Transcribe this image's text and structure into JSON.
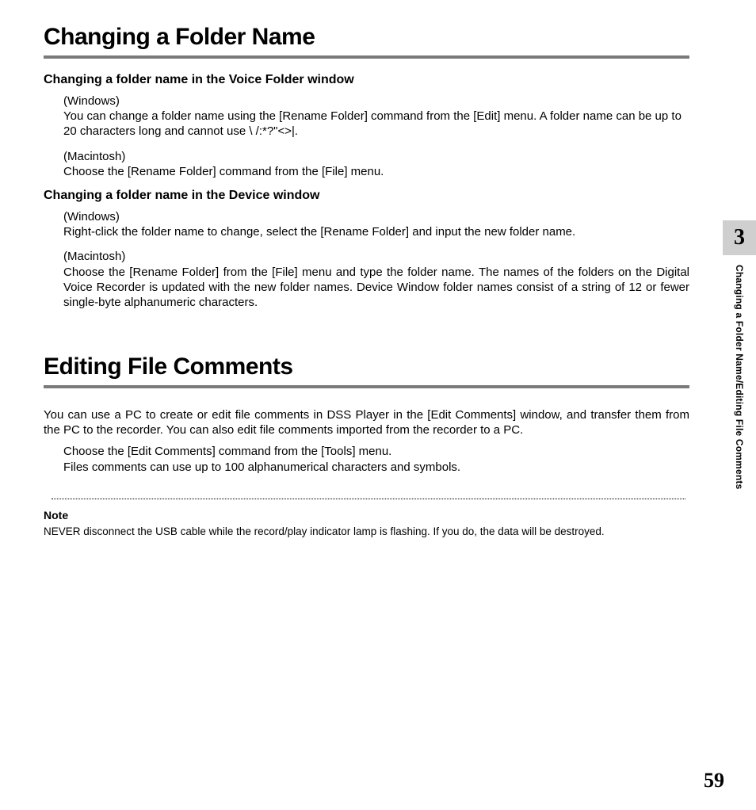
{
  "section1": {
    "title": "Changing a Folder Name",
    "sub1": "Changing a folder name in the Voice Folder window",
    "block1a_os": "(Windows)",
    "block1a_text": "You can change a folder name using the [Rename Folder] command from the [Edit] menu. A folder name can be up to 20 characters long and cannot use \\ /:*?\"<>|.",
    "block1b_os": "(Macintosh)",
    "block1b_text": "Choose the [Rename Folder] command from the [File] menu.",
    "sub2": "Changing a folder name in the Device window",
    "block2a_os": "(Windows)",
    "block2a_text": "Right-click the folder name to change, select the [Rename Folder] and input the new folder name.",
    "block2b_os": "(Macintosh)",
    "block2b_text": "Choose the [Rename Folder] from the [File] menu and type the folder name.",
    "block2b_text2": "The names of the folders on the Digital Voice Recorder is updated with the new folder names. Device Window folder names consist of a string of 12 or fewer single-byte alphanumeric characters."
  },
  "section2": {
    "title": "Editing File Comments",
    "intro": "You can use a PC to create or edit file comments in DSS Player in the [Edit Comments] window, and transfer them from the PC to the recorder. You can also edit file comments imported from the recorder to a PC.",
    "line1": "Choose the [Edit Comments] command from the [Tools] menu.",
    "line2": "Files comments can use up to 100 alphanumerical characters and symbols.",
    "note_label": "Note",
    "note_text": "NEVER disconnect the USB cable while the record/play indicator lamp is flashing. If you do, the data will be destroyed."
  },
  "side": {
    "chapter_num": "3",
    "running_head": "Changing a Folder Name/Editing File Comments"
  },
  "page_number": "59"
}
